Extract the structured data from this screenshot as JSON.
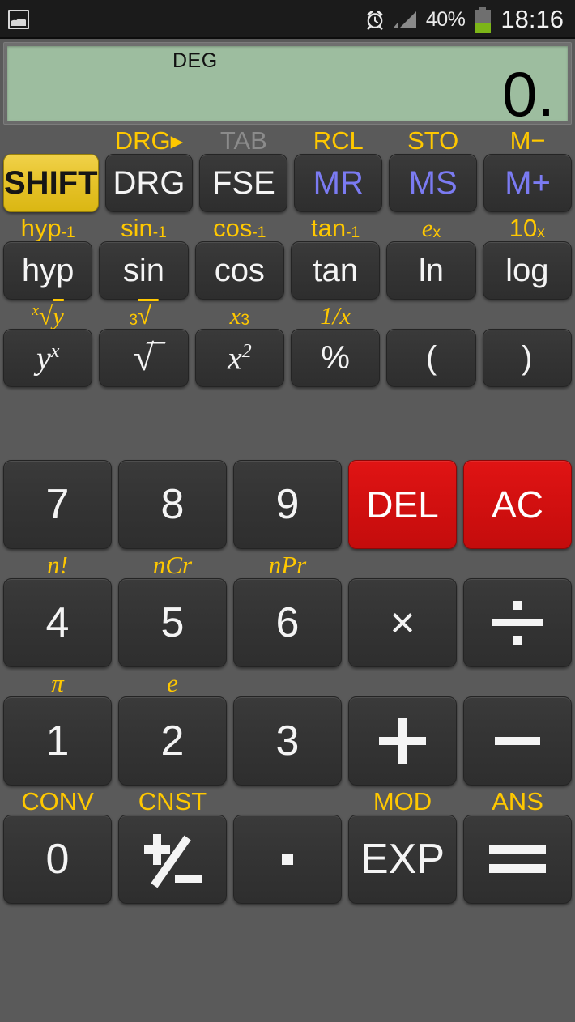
{
  "statusbar": {
    "gallery_icon": "gallery-icon",
    "alarm_icon": "alarm-clock-icon",
    "signal_icon": "signal-bars-icon",
    "battery_icon": "battery-icon",
    "battery_percent": "40%",
    "time": "18:16",
    "battery_level": 40,
    "battery_fill_color": "#7cb518",
    "bg_color": "#1b1b1b"
  },
  "display": {
    "mode": "DEG",
    "value": "0.",
    "bg_color": "#9dbd9f",
    "text_color": "#000000"
  },
  "colors": {
    "shift_yellow": "#e7c32b",
    "label_yellow": "#ffc800",
    "memory_violet": "#7b7bf2",
    "danger_red": "#d31010",
    "key_dark": "#343434",
    "background": "#5a5a5a",
    "disabled_gray": "#8b8b8b"
  },
  "keypad": {
    "scientific_rows": [
      {
        "row_name": "memory-row",
        "keys": [
          {
            "label": "SHIFT",
            "shift": "",
            "style": "shift",
            "name": "shift"
          },
          {
            "label": "DRG",
            "shift": "DRG▸",
            "style": "plain",
            "name": "drg"
          },
          {
            "label": "FSE",
            "shift": "TAB",
            "style": "plain",
            "shift_style": "dim",
            "name": "fse"
          },
          {
            "label": "MR",
            "shift": "RCL",
            "style": "mem",
            "name": "mr"
          },
          {
            "label": "MS",
            "shift": "STO",
            "style": "mem",
            "name": "ms"
          },
          {
            "label": "M+",
            "shift": "M−",
            "style": "mem",
            "name": "m-plus"
          }
        ]
      },
      {
        "row_name": "trig-row",
        "keys": [
          {
            "label": "hyp",
            "shift": "hyp⁻¹",
            "style": "plain",
            "name": "hyp"
          },
          {
            "label": "sin",
            "shift": "sin⁻¹",
            "style": "plain",
            "name": "sin"
          },
          {
            "label": "cos",
            "shift": "cos⁻¹",
            "style": "plain",
            "name": "cos"
          },
          {
            "label": "tan",
            "shift": "tan⁻¹",
            "style": "plain",
            "name": "tan"
          },
          {
            "label": "ln",
            "shift": "eˣ",
            "style": "plain",
            "name": "ln"
          },
          {
            "label": "log",
            "shift": "10ˣ",
            "style": "plain",
            "name": "log"
          }
        ]
      },
      {
        "row_name": "power-row",
        "keys": [
          {
            "label": "yˣ",
            "shift": "ˣ√y",
            "style": "plain",
            "name": "y-to-x"
          },
          {
            "label": "√",
            "shift": "³√",
            "style": "plain",
            "name": "square-root"
          },
          {
            "label": "x²",
            "shift": "x³",
            "style": "plain",
            "name": "x-squared"
          },
          {
            "label": "%",
            "shift": "1/x",
            "style": "plain",
            "name": "percent"
          },
          {
            "label": "(",
            "shift": "",
            "style": "plain",
            "name": "open-paren"
          },
          {
            "label": ")",
            "shift": "",
            "style": "plain",
            "name": "close-paren"
          }
        ]
      }
    ],
    "number_rows": [
      {
        "row_name": "row-789",
        "keys": [
          {
            "label": "7",
            "shift": "",
            "style": "plain",
            "name": "7"
          },
          {
            "label": "8",
            "shift": "",
            "style": "plain",
            "name": "8"
          },
          {
            "label": "9",
            "shift": "",
            "style": "plain",
            "name": "9"
          },
          {
            "label": "DEL",
            "shift": "",
            "style": "danger",
            "name": "delete"
          },
          {
            "label": "AC",
            "shift": "",
            "style": "danger",
            "name": "all-clear"
          }
        ]
      },
      {
        "row_name": "row-456",
        "keys": [
          {
            "label": "4",
            "shift": "n!",
            "style": "plain",
            "name": "4"
          },
          {
            "label": "5",
            "shift": "nCr",
            "style": "plain",
            "name": "5"
          },
          {
            "label": "6",
            "shift": "nPr",
            "style": "plain",
            "name": "6"
          },
          {
            "label": "×",
            "shift": "",
            "style": "plain",
            "name": "multiply"
          },
          {
            "label": "÷",
            "shift": "",
            "style": "plain",
            "name": "divide"
          }
        ]
      },
      {
        "row_name": "row-123",
        "keys": [
          {
            "label": "1",
            "shift": "π",
            "style": "plain",
            "name": "1"
          },
          {
            "label": "2",
            "shift": "e",
            "style": "plain",
            "name": "2"
          },
          {
            "label": "3",
            "shift": "",
            "style": "plain",
            "name": "3"
          },
          {
            "label": "+",
            "shift": "",
            "style": "plain",
            "name": "plus"
          },
          {
            "label": "−",
            "shift": "",
            "style": "plain",
            "name": "minus"
          }
        ]
      },
      {
        "row_name": "row-0",
        "keys": [
          {
            "label": "0",
            "shift": "CONV",
            "style": "plain",
            "name": "0"
          },
          {
            "label": "±",
            "shift": "CNST",
            "style": "plain",
            "name": "sign-toggle"
          },
          {
            "label": "·",
            "shift": "",
            "style": "plain",
            "name": "decimal-point"
          },
          {
            "label": "EXP",
            "shift": "MOD",
            "style": "plain",
            "name": "exponent"
          },
          {
            "label": "=",
            "shift": "ANS",
            "style": "plain",
            "name": "equals"
          }
        ]
      }
    ]
  }
}
